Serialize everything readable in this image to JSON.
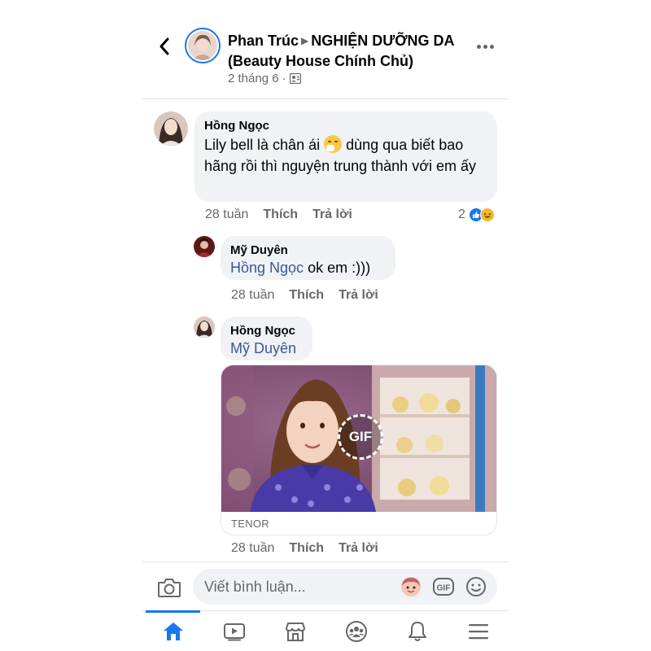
{
  "header": {
    "author": "Phan Trúc",
    "group": "NGHIỆN DƯỠNG DA (Beauty House Chính Chủ)",
    "date": "2 tháng 6 ·"
  },
  "comments": [
    {
      "name": "Hồng Ngọc",
      "text_before": "Lily bell là chân ái",
      "text_after": "dùng qua biết bao hãng rồi thì nguyện trung thành với em ấy",
      "time": "28 tuần",
      "like_label": "Thích",
      "reply_label": "Trả lời",
      "reaction_count": "2"
    },
    {
      "name": "Mỹ Duyên",
      "mention": "Hồng Ngọc",
      "text": "ok em :)))",
      "time": "28 tuần",
      "like_label": "Thích",
      "reply_label": "Trả lời"
    },
    {
      "name": "Hồng Ngọc",
      "mention": "Mỹ Duyên",
      "gif_label": "GIF",
      "gif_source": "TENOR",
      "time": "28 tuần",
      "like_label": "Thích",
      "reply_label": "Trả lời"
    }
  ],
  "composer": {
    "placeholder": "Viết bình luận...",
    "gif_button": "GIF"
  },
  "nav": {
    "items": [
      "home",
      "watch",
      "marketplace",
      "groups",
      "notifications",
      "menu"
    ],
    "active": "home"
  },
  "colors": {
    "accent": "#1877f2",
    "mention": "#385898",
    "bubble": "#f0f2f5",
    "secondary_text": "#65676b"
  }
}
